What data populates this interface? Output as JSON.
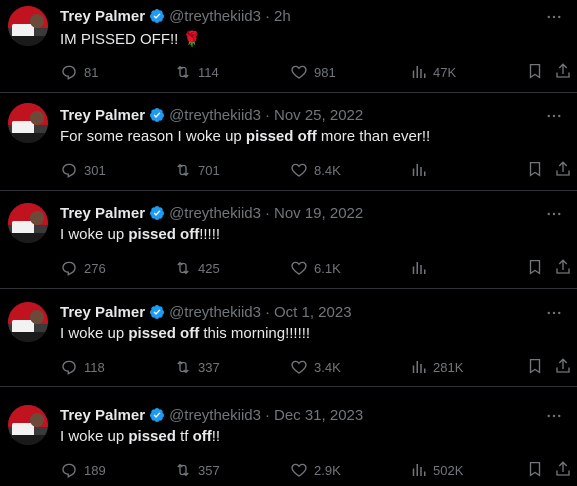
{
  "tweets": [
    {
      "name": "Trey Palmer",
      "handle": "@treythekiid3",
      "time": "2h",
      "text": [
        {
          "t": "IM PISSED OFF!! ",
          "b": false
        }
      ],
      "emoji": "🌹",
      "replies": "81",
      "retweets": "114",
      "likes": "981",
      "views": "47K"
    },
    {
      "name": "Trey Palmer",
      "handle": "@treythekiid3",
      "time": "Nov 25, 2022",
      "text": [
        {
          "t": "For some reason I woke up ",
          "b": false
        },
        {
          "t": "pissed off",
          "b": true
        },
        {
          "t": " more than ever!!",
          "b": false
        }
      ],
      "emoji": "",
      "replies": "301",
      "retweets": "701",
      "likes": "8.4K",
      "views": ""
    },
    {
      "name": "Trey Palmer",
      "handle": "@treythekiid3",
      "time": "Nov 19, 2022",
      "text": [
        {
          "t": "I woke up ",
          "b": false
        },
        {
          "t": "pissed off",
          "b": true
        },
        {
          "t": "!!!!!",
          "b": false
        }
      ],
      "emoji": "",
      "replies": "276",
      "retweets": "425",
      "likes": "6.1K",
      "views": ""
    },
    {
      "name": "Trey Palmer",
      "handle": "@treythekiid3",
      "time": "Oct 1, 2023",
      "text": [
        {
          "t": "I woke up ",
          "b": false
        },
        {
          "t": "pissed off",
          "b": true
        },
        {
          "t": " this morning!!!!!!",
          "b": false
        }
      ],
      "emoji": "",
      "replies": "118",
      "retweets": "337",
      "likes": "3.4K",
      "views": "281K"
    },
    {
      "name": "Trey Palmer",
      "handle": "@treythekiid3",
      "time": "Dec 31, 2023",
      "text": [
        {
          "t": "I woke up ",
          "b": false
        },
        {
          "t": "pissed",
          "b": true
        },
        {
          "t": " tf ",
          "b": false
        },
        {
          "t": "off",
          "b": true
        },
        {
          "t": "!!",
          "b": false
        }
      ],
      "emoji": "",
      "replies": "189",
      "retweets": "357",
      "likes": "2.9K",
      "views": "502K"
    }
  ],
  "colors": {
    "background": "#000000",
    "text": "#e7e9ea",
    "muted": "#71767b",
    "verified": "#1d9bf0",
    "divider": "#2f3336"
  },
  "icons": [
    "reply-icon",
    "retweet-icon",
    "like-icon",
    "views-icon",
    "bookmark-icon",
    "share-icon",
    "more-icon",
    "verified-badge-icon"
  ]
}
